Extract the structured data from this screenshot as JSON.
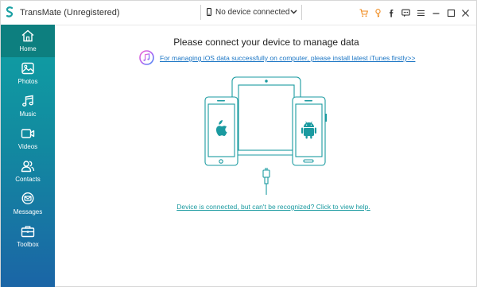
{
  "app": {
    "title": "TransMate (Unregistered)"
  },
  "device_selector": {
    "label": "No device connected"
  },
  "toolbar": {
    "icons": [
      "cart-icon",
      "key-icon",
      "facebook-icon",
      "chat-icon",
      "menu-icon",
      "minimize-icon",
      "maximize-icon",
      "close-icon"
    ]
  },
  "sidebar": {
    "items": [
      {
        "label": "Home",
        "icon": "home-icon",
        "active": true
      },
      {
        "label": "Photos",
        "icon": "photos-icon",
        "active": false
      },
      {
        "label": "Music",
        "icon": "music-icon",
        "active": false
      },
      {
        "label": "Videos",
        "icon": "videos-icon",
        "active": false
      },
      {
        "label": "Contacts",
        "icon": "contacts-icon",
        "active": false
      },
      {
        "label": "Messages",
        "icon": "messages-icon",
        "active": false
      },
      {
        "label": "Toolbox",
        "icon": "toolbox-icon",
        "active": false
      }
    ]
  },
  "main": {
    "title": "Please connect your device to manage data",
    "itunes_link": "For managing iOS data successfully on computer, please install latest iTunes firstly>>",
    "help_link": "Device is connected, but can't be recognized? Click to view help."
  },
  "colors": {
    "accent": "#1a9aa0",
    "sidebar_top": "#0fa0a3",
    "sidebar_bottom": "#1b65a6",
    "sidebar_active": "#0d7f7f",
    "toolbar_orange": "#f08a1c",
    "link_blue": "#1a75c4"
  }
}
